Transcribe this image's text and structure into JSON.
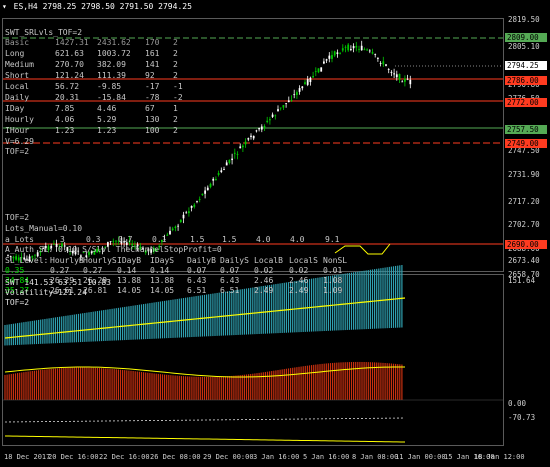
{
  "header": {
    "symbol": "ES,H4",
    "ohlc": "2798.25 2798.50 2791.50 2794.25"
  },
  "colors": {
    "bg": "#000000",
    "bull": "#00c800",
    "bear": "#ffffff",
    "level_green": "#55aa55",
    "level_red": "#ff3b20",
    "level_yellow": "#ffff00",
    "hist_cyan": "#2fa0b0",
    "hist_red": "#c83010"
  },
  "info": {
    "title": "SWT_SRLvls_TOF=2",
    "rows": [
      {
        "name": "Basic",
        "a": "1427.31",
        "b": "2431.62",
        "c": "170",
        "d": "2",
        "color": "#9a9a9a"
      },
      {
        "name": "Long",
        "a": "621.63",
        "b": "1003.72",
        "c": "161",
        "d": "2",
        "color": "#c8c8c8"
      },
      {
        "name": "Medium",
        "a": "270.70",
        "b": "382.09",
        "c": "141",
        "d": "2",
        "color": "#c8c8c8"
      },
      {
        "name": "Short",
        "a": "121.24",
        "b": "111.39",
        "c": "92",
        "d": "2",
        "color": "#c8c8c8"
      },
      {
        "name": "Local",
        "a": "56.72",
        "b": "-9.85",
        "c": "-17",
        "d": "-1",
        "color": "#c8c8c8"
      },
      {
        "name": "Daily",
        "a": "20.31",
        "b": "-15.84",
        "c": "-78",
        "d": "-2",
        "color": "#c8c8c8"
      },
      {
        "name": "IDay",
        "a": "7.85",
        "b": "4.46",
        "c": "67",
        "d": "1",
        "color": "#c8c8c8"
      },
      {
        "name": "Hourly",
        "a": "4.06",
        "b": "5.29",
        "c": "130",
        "d": "2",
        "color": "#c8c8c8"
      },
      {
        "name": "IHour",
        "a": "1.23",
        "b": "1.23",
        "c": "100",
        "d": "2",
        "color": "#c8c8c8"
      }
    ],
    "v_line": "V=6.29",
    "tof_line": "TOF=2"
  },
  "lower_info": {
    "tof": "TOF=2",
    "lots": "Lots_Manual=0.10",
    "a_row": [
      "a_Lots",
      "3",
      "0.3",
      "0.7",
      "0.1",
      "1.5",
      "1.5",
      "4.0",
      "4.0",
      "9.1"
    ],
    "auth_row": "A_Auth  SL: 0.10  S/Slvl  TheChannelStopProfit=0",
    "sl_header": [
      "SL_Level:",
      "HourlyB",
      "HourlyS",
      "IDayB",
      "IDayS",
      "DailyB",
      "DailyS",
      "LocalB",
      "LocalS",
      "NonSL"
    ],
    "sl_rows": [
      {
        "color": "#00e000",
        "v": [
          "0.35",
          "0.27",
          "0.27",
          "0.14",
          "0.14",
          "0.07",
          "0.07",
          "0.02",
          "0.02",
          "0.01"
        ]
      },
      {
        "color": "#00e000",
        "v": [
          "34.84",
          "26.29",
          "26.29",
          "13.88",
          "13.88",
          "6.43",
          "6.43",
          "2.46",
          "2.46",
          "1.08"
        ]
      },
      {
        "color": "#00e000",
        "v": [
          "35.27",
          "26.61",
          "26.81",
          "14.05",
          "14.05",
          "6.51",
          "6.51",
          "2.49",
          "2.49",
          "1.09"
        ]
      }
    ]
  },
  "price_axis": [
    "2819.50",
    "2805.10",
    "2790.80",
    "2776.50",
    "2761.90",
    "2747.50",
    "2731.90",
    "2717.20",
    "2702.70",
    "2688.00",
    "2673.40",
    "2658.70"
  ],
  "price_tags": [
    {
      "label": "2809.00",
      "bg": "#55aa55",
      "fg": "#000"
    },
    {
      "label": "2794.25",
      "bg": "#ffffff",
      "fg": "#000"
    },
    {
      "label": "2786.00",
      "bg": "#ff3b20",
      "fg": "#000"
    },
    {
      "label": "2772.00",
      "bg": "#ff3b20",
      "fg": "#000"
    },
    {
      "label": "2757.50",
      "bg": "#55aa55",
      "fg": "#000"
    },
    {
      "label": "2749.00",
      "bg": "#ff3b20",
      "fg": "#000"
    },
    {
      "label": "2690.00",
      "bg": "#ff3b20",
      "fg": "#000"
    }
  ],
  "indicator": {
    "title": "SWT 141.53 63.51 10.83",
    "volatility": "Volatility=121.24",
    "tof": "TOF=2",
    "axis": [
      "151.64",
      "0.00",
      "-70.73"
    ]
  },
  "time_axis": [
    "18 Dec 2017",
    "20 Dec 16:00",
    "22 Dec 16:00",
    "26 Dec 08:00",
    "29 Dec 00:00",
    "3 Jan 16:00",
    "5 Jan 16:00",
    "8 Jan 08:00",
    "11 Jan 00:00",
    "15 Jan 16:00",
    "18 Jan 12:00"
  ]
}
